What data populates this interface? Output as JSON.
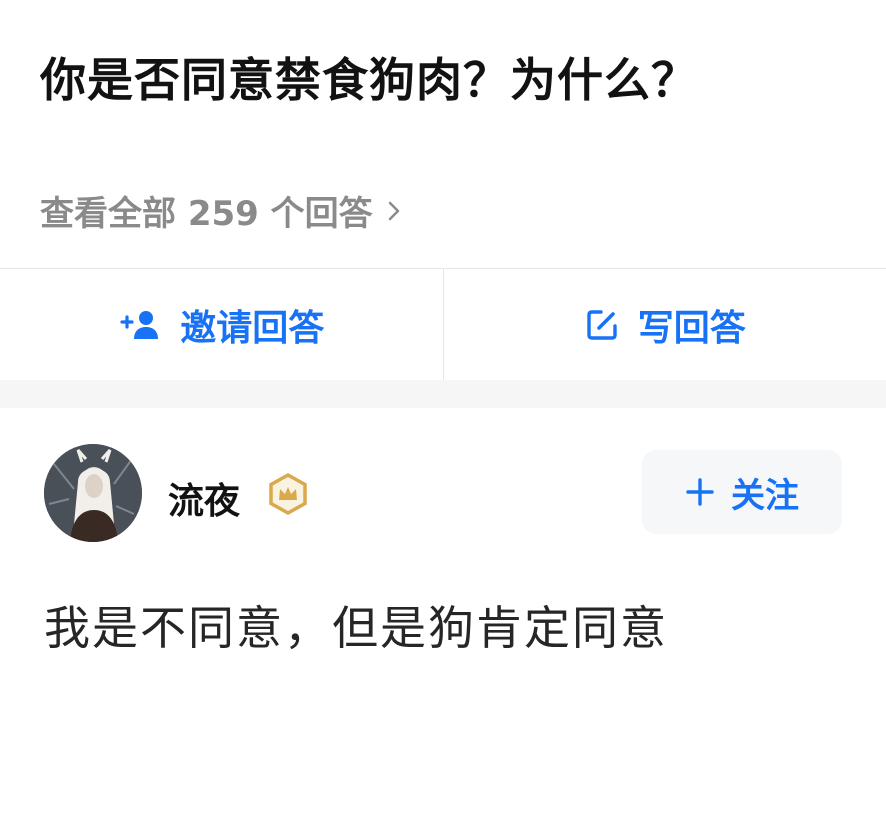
{
  "question": {
    "title": "你是否同意禁食狗肉？为什么？",
    "view_all_label": "查看全部 259 个回答"
  },
  "actions": {
    "invite_label": "邀请回答",
    "write_label": "写回答"
  },
  "answer": {
    "author_name": "流夜",
    "follow_label": "关注",
    "content": "我是不同意，但是狗肯定同意"
  },
  "icons": {
    "view_all": "chevron-right-icon",
    "invite": "add-user-icon",
    "write": "edit-icon",
    "badge": "crown-badge-icon",
    "follow": "plus-icon"
  },
  "colors": {
    "accent": "#1772f6",
    "title": "#121212",
    "muted": "#8a8a8a",
    "badge_gold": "#d9a94b",
    "divider": "#e6e6e6",
    "section_bg": "#f6f6f6"
  }
}
